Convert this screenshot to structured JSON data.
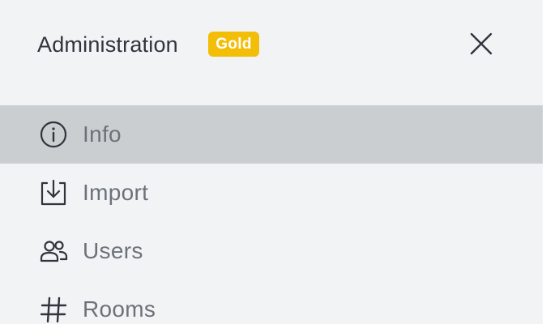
{
  "header": {
    "title": "Administration",
    "badge": "Gold",
    "close_icon": "close-icon"
  },
  "nav": {
    "items": [
      {
        "label": "Info",
        "icon": "info-icon",
        "active": true
      },
      {
        "label": "Import",
        "icon": "import-icon",
        "active": false
      },
      {
        "label": "Users",
        "icon": "users-icon",
        "active": false
      },
      {
        "label": "Rooms",
        "icon": "hash-icon",
        "active": false
      }
    ]
  },
  "colors": {
    "panel_background": "#f2f3f5",
    "active_item_background": "#cbced1",
    "badge_background": "#f3be08",
    "title_text": "#2f343d",
    "item_text": "#6c727a",
    "icon_stroke": "#2f343d"
  }
}
